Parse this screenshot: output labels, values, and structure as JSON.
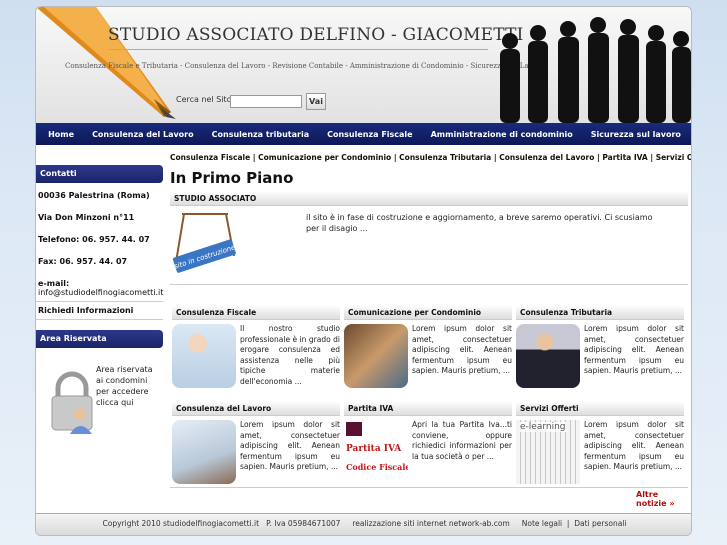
{
  "header": {
    "title": "STUDIO ASSOCIATO DELFINO - GIACOMETTI",
    "tagline": "Consulenza Fiscale e Tributaria - Consulenza del Lavoro - Revisione Contabile - Amministrazione di Condominio - Sicurezza sul Lavoro",
    "search_label": "Cerca nel Sito",
    "search_value": "",
    "search_button": "Vai"
  },
  "nav": [
    "Home",
    "Consulenza del Lavoro",
    "Consulenza tributaria",
    "Consulenza Fiscale",
    "Amministrazione di condominio",
    "Sicurezza sul lavoro"
  ],
  "sidebar": {
    "contatti_title": "Contatti",
    "address1": "00036 Palestrina (Roma)",
    "address2": "Via Don Minzoni n°11",
    "phone": "Telefono: 06. 957. 44. 07",
    "fax": "Fax: 06. 957. 44. 07",
    "email_label": "e-mail:",
    "email": "info@studiodelfinogiacometti.it",
    "info_link": "Richiedi Informazioni",
    "area_title": "Area Riservata",
    "area_text": "Area riservata ai condomini per accedere clicca qui"
  },
  "content": {
    "subnav": "Consulenza Fiscale | Comunicazione per Condominio | Consulenza Tributaria | Consulenza del Lavoro | Partita IVA | Servizi Offerti",
    "heading": "In Primo Piano",
    "featured_title": "STUDIO ASSOCIATO",
    "featured_badge": "sito in costruzione",
    "featured_text": "il sito è in fase di costruzione e aggiornamento, a breve saremo operativi.  Ci scusiamo per il disagio ...",
    "cards": [
      {
        "title": "Consulenza Fiscale",
        "text": "Il nostro studio professionale è in grado di erogare consulenza ed assistenza nelle più tipiche materie dell'economia ..."
      },
      {
        "title": "Comunicazione per Condominio",
        "text": "Lorem ipsum dolor sit amet, consectetuer adipiscing elit. Aenean fermentum ipsum eu sapien. Mauris pretium, ..."
      },
      {
        "title": "Consulenza Tributaria",
        "text": "Lorem ipsum dolor sit amet, consectetuer adipiscing elit. Aenean fermentum ipsum eu sapien. Mauris pretium, ..."
      },
      {
        "title": "Consulenza del Lavoro",
        "text": "Lorem ipsum dolor sit amet, consectetuer adipiscing elit. Aenean fermentum ipsum eu sapien. Mauris pretium, ..."
      },
      {
        "title": "Partita IVA",
        "text": "Apri la tua Partita Iva...ti conviene, oppure richiedici informazioni per la tua società o per ...",
        "thumb_line1": "Partita IVA",
        "thumb_line2": "Codice Fiscale"
      },
      {
        "title": "Servizi Offerti",
        "text": "Lorem ipsum dolor sit amet, consectetuer adipiscing elit. Aenean fermentum ipsum eu sapien. Mauris pretium, ...",
        "thumb_label": "e-learning"
      }
    ],
    "more": "Altre notizie »"
  },
  "footer": {
    "copyright": "Copyright 2010 studiodelfinogiacometti.it",
    "piva": "P. Iva 05984671007",
    "realizzazione": "realizzazione siti internet network-ab.com",
    "legal": "Note legali",
    "privacy": "Dati personali"
  },
  "colors": {
    "nav": "#1a2a7c",
    "more_link": "#b01010"
  }
}
